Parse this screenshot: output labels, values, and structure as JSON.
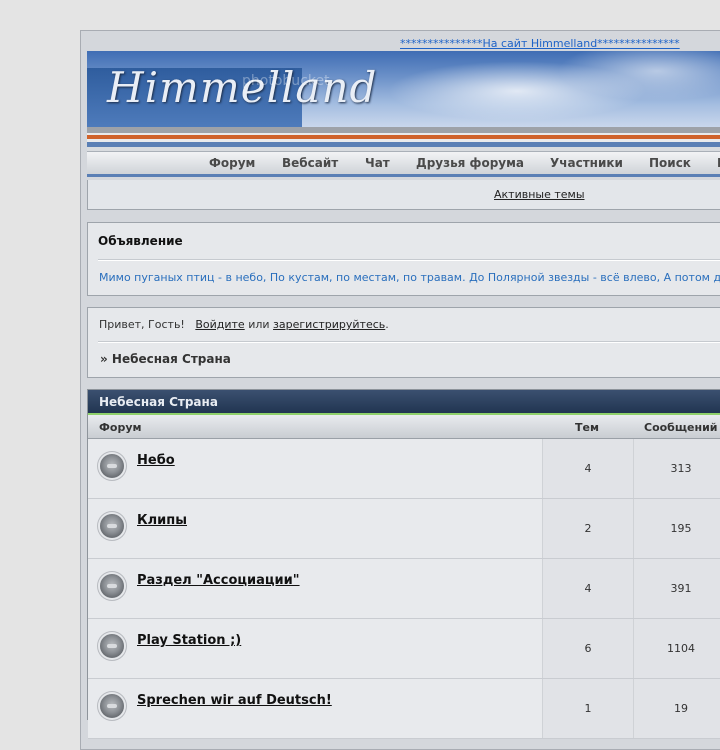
{
  "header": {
    "top_link": "***************На сайт Himmelland***************",
    "logo_text": "Himmelland",
    "photobucket_watermark": "photobucket"
  },
  "colors": {
    "accent_blue": "#5a7fb5",
    "link_blue": "#1e63c8",
    "category_header": "#213551",
    "stripe_orange": "#d0622a"
  },
  "nav": {
    "items": [
      {
        "label": "Форум"
      },
      {
        "label": "Вебсайт"
      },
      {
        "label": "Чат"
      },
      {
        "label": "Друзья форума"
      },
      {
        "label": "Участники"
      },
      {
        "label": "Поиск"
      },
      {
        "label": "Р"
      }
    ],
    "active_topics": "Активные темы"
  },
  "announcement": {
    "title": "Объявление",
    "text": "Мимо пуганых птиц - в небо, По кустам, по местам, по травам. До Полярной звезды - всё влево, А потом д"
  },
  "welcome": {
    "greeting": "Привет, Гость!",
    "login": "Войдите",
    "or": "или",
    "register": "зарегистрируйтесь",
    "period": ".",
    "breadcrumb": "» Небесная Страна"
  },
  "category": {
    "title": "Небесная Страна",
    "columns": {
      "forum": "Форум",
      "topics": "Тем",
      "posts": "Сообщений"
    },
    "forums": [
      {
        "name": "Небо",
        "topics": "4",
        "posts": "313",
        "icon": "forum-status-icon"
      },
      {
        "name": "Клипы",
        "topics": "2",
        "posts": "195",
        "icon": "forum-status-icon"
      },
      {
        "name": "Раздел \"Ассоциации\"",
        "topics": "4",
        "posts": "391",
        "icon": "forum-status-icon"
      },
      {
        "name": "Play Station ;)",
        "topics": "6",
        "posts": "1104",
        "icon": "forum-status-icon"
      },
      {
        "name": "Sprechen wir auf Deutsch!",
        "topics": "1",
        "posts": "19",
        "icon": "forum-status-icon"
      }
    ]
  }
}
